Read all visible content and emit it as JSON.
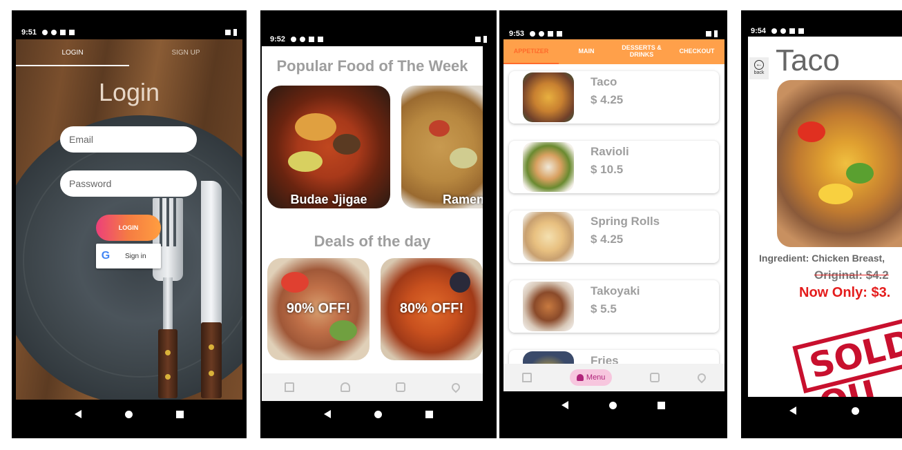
{
  "screens": {
    "login": {
      "status_time": "9:51",
      "tabs": [
        "LOGIN",
        "SIGN UP"
      ],
      "title": "Login",
      "email_placeholder": "Email",
      "password_placeholder": "Password",
      "login_button": "LOGIN",
      "google_button": "Sign in"
    },
    "home": {
      "status_time": "9:52",
      "popular_title": "Popular Food of The Week",
      "popular_items": [
        "Budae Jjigae",
        "Ramen"
      ],
      "deals_title": "Deals of the day",
      "deals": [
        "90% OFF!",
        "80% OFF!"
      ],
      "bottom_nav": [
        "home-icon",
        "bell-icon",
        "contact-icon",
        "location-icon"
      ]
    },
    "menu": {
      "status_time": "9:53",
      "tabs": [
        "APPETIZER",
        "MAIN",
        "DESSERTS & DRINKS",
        "CHECKOUT"
      ],
      "items": [
        {
          "name": "Taco",
          "price": "$ 4.25"
        },
        {
          "name": "Ravioli",
          "price": "$ 10.5"
        },
        {
          "name": "Spring Rolls",
          "price": "$ 4.25"
        },
        {
          "name": "Takoyaki",
          "price": "$ 5.5"
        },
        {
          "name": "Fries",
          "price": ""
        }
      ],
      "bottom_nav_active": "Menu"
    },
    "detail": {
      "status_time": "9:54",
      "back_label": "back",
      "title": "Taco",
      "ingredient": "Ingredient: Chicken Breast,",
      "original_price": "Original: $4.2",
      "now_price": "Now Only: $3.",
      "stamp": "SOLD OU"
    }
  },
  "colors": {
    "accent_orange": "#ffa04a",
    "sale_red": "#e41c1c",
    "gray_text": "#9e9e9e"
  }
}
